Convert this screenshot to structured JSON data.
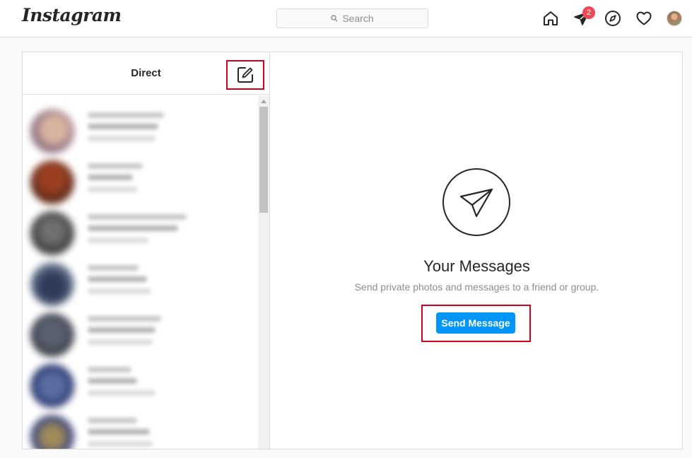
{
  "nav": {
    "logo": "Instagram",
    "search_placeholder": "Search",
    "direct_badge": "2",
    "icons": [
      "home-icon",
      "direct-icon",
      "explore-icon",
      "activity-heart-icon",
      "profile-avatar"
    ]
  },
  "inbox": {
    "title": "Direct",
    "compose_icon": "new-message-icon"
  },
  "empty_state": {
    "icon": "paper-plane-icon",
    "title": "Your Messages",
    "subtitle": "Send private photos and messages to a friend or group.",
    "button_label": "Send Message"
  },
  "colors": {
    "accent": "#0095f6",
    "badge": "#ed4956",
    "highlight_box": "#d0021b",
    "border": "#dbdbdb"
  }
}
